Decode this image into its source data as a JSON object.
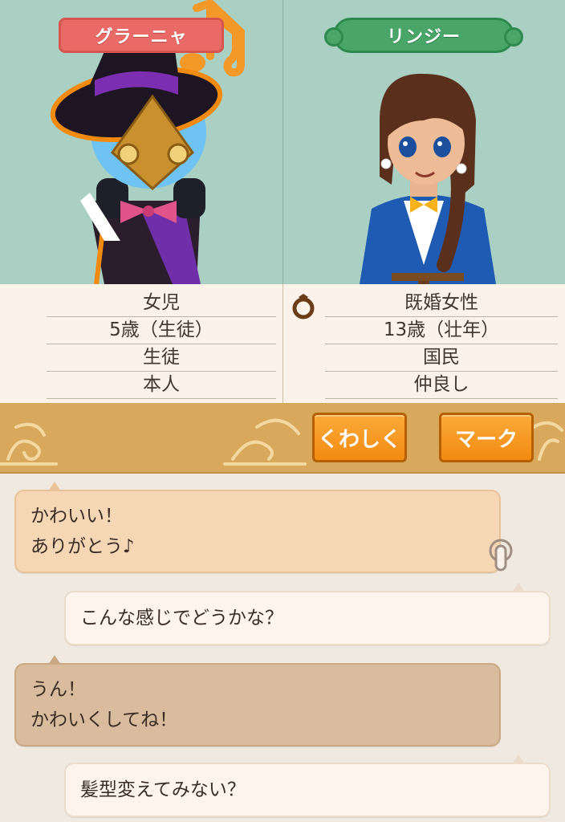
{
  "characters": {
    "left": {
      "name": "グラーニャ",
      "gender": "女児",
      "age": "5歳（生徒）",
      "job": "生徒",
      "relation": "本人"
    },
    "right": {
      "name": "リンジー",
      "gender": "既婚女性",
      "age": "13歳（壮年）",
      "job": "国民",
      "relation": "仲良し",
      "married_icon": "ring-icon"
    }
  },
  "buttons": {
    "detail_label": "くわしく",
    "mark_label": "マーク"
  },
  "chat": [
    {
      "side": "left",
      "line1": "かわいい！",
      "line2": "ありがとう♪"
    },
    {
      "side": "right",
      "line1": "こんな感じでどうかな？"
    },
    {
      "side": "left",
      "line1": "うん！",
      "line2": "かわいくしてね！"
    },
    {
      "side": "right",
      "line1": "髪型変えてみない？"
    }
  ],
  "colors": {
    "portrait_bg": "#a9d0c2",
    "left_name_plate": "#ea6a67",
    "right_name_plate": "#4aa569",
    "button_orange": "#f28a10",
    "banner": "#d8a95c"
  }
}
